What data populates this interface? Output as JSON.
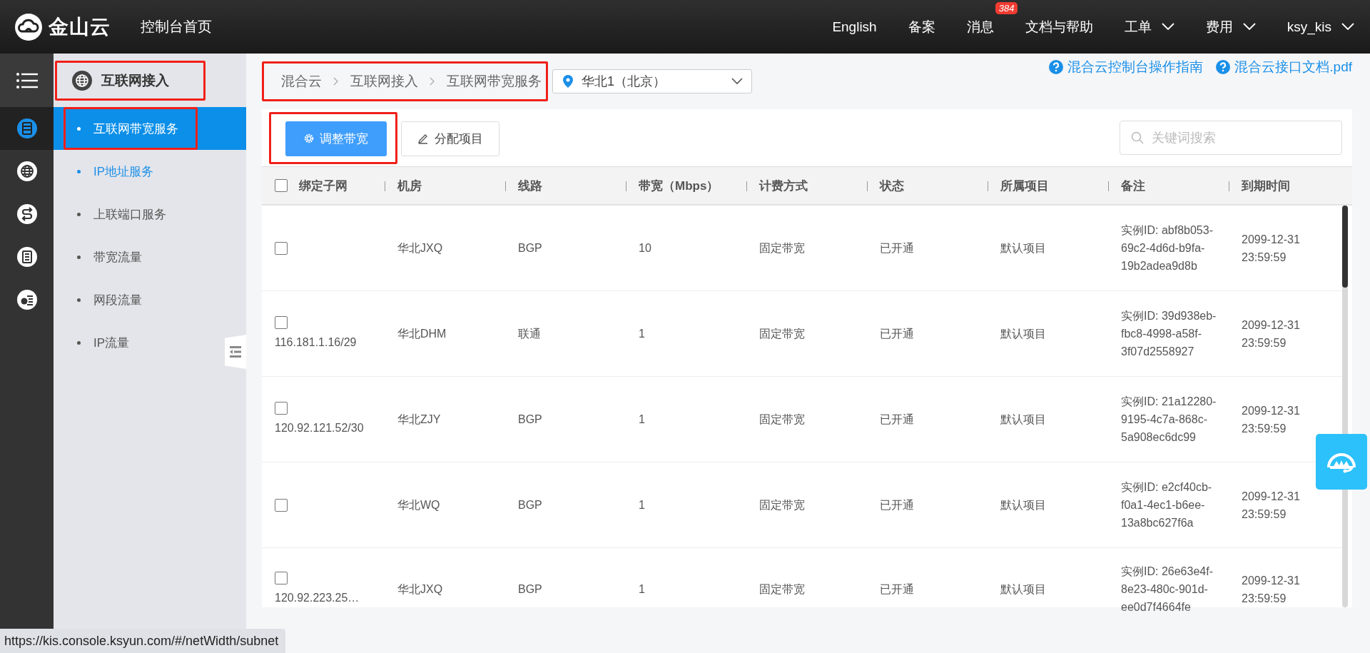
{
  "top_bar": {
    "logo_text": "金山云",
    "home_link": "控制台首页",
    "nav": [
      {
        "label": "English",
        "kind": "link"
      },
      {
        "label": "备案",
        "kind": "link"
      },
      {
        "label": "消息",
        "kind": "badge",
        "badge": "384"
      },
      {
        "label": "文档与帮助",
        "kind": "link"
      },
      {
        "label": "工单",
        "kind": "dropdown"
      },
      {
        "label": "费用",
        "kind": "dropdown"
      },
      {
        "label": "ksy_kis",
        "kind": "dropdown"
      }
    ]
  },
  "icon_rail": {
    "items": [
      {
        "kind": "server",
        "selected": true
      },
      {
        "kind": "globe",
        "selected": false
      },
      {
        "kind": "transfer",
        "selected": false
      },
      {
        "kind": "list",
        "selected": false
      },
      {
        "kind": "billing",
        "selected": false
      }
    ]
  },
  "sidebar": {
    "title": "互联网接入",
    "title_outlined": true,
    "items": [
      {
        "label": "互联网带宽服务",
        "selected": true,
        "hovered": false,
        "outlined": true
      },
      {
        "label": "IP地址服务",
        "selected": false,
        "hovered": true,
        "outlined": false
      },
      {
        "label": "上联端口服务",
        "selected": false,
        "hovered": false,
        "outlined": false
      },
      {
        "label": "带宽流量",
        "selected": false,
        "hovered": false,
        "outlined": false
      },
      {
        "label": "网段流量",
        "selected": false,
        "hovered": false,
        "outlined": false
      },
      {
        "label": "IP流量",
        "selected": false,
        "hovered": false,
        "outlined": false
      }
    ]
  },
  "breadcrumb": {
    "outlined": true,
    "items": [
      "混合云",
      "互联网接入",
      "互联网带宽服务"
    ]
  },
  "region_select": {
    "value": "华北1（北京）"
  },
  "help_links": [
    "混合云控制台操作指南",
    "混合云接口文档.pdf"
  ],
  "toolbar": {
    "buttons": [
      {
        "label": "调整带宽",
        "kind": "primary",
        "outlined": true
      },
      {
        "label": "分配项目",
        "kind": "default",
        "outlined": false
      }
    ],
    "search": {
      "placeholder": "关键词搜索"
    }
  },
  "table": {
    "header_checked": false,
    "columns": [
      "绑定子网",
      "机房",
      "线路",
      "带宽（Mbps）",
      "计费方式",
      "状态",
      "所属项目",
      "备注",
      "到期时间"
    ],
    "rows": [
      {
        "checked": false,
        "cells": [
          "",
          "华北JXQ",
          "BGP",
          "10",
          "固定带宽",
          "已开通",
          "默认项目",
          "实例ID: abf8b053-69c2-4d6d-b9fa-19b2adea9d8b",
          "2099-12-31 23:59:59"
        ]
      },
      {
        "checked": false,
        "cells": [
          "116.181.1.16/29",
          "华北DHM",
          "联通",
          "1",
          "固定带宽",
          "已开通",
          "默认项目",
          "实例ID: 39d938eb-fbc8-4998-a58f-3f07d2558927",
          "2099-12-31 23:59:59"
        ]
      },
      {
        "checked": false,
        "cells": [
          "120.92.121.52/30",
          "华北ZJY",
          "BGP",
          "1",
          "固定带宽",
          "已开通",
          "默认项目",
          "实例ID: 21a12280-9195-4c7a-868c-5a908ec6dc99",
          "2099-12-31 23:59:59"
        ]
      },
      {
        "checked": false,
        "cells": [
          "",
          "华北WQ",
          "BGP",
          "1",
          "固定带宽",
          "已开通",
          "默认项目",
          "实例ID: e2cf40cb-f0a1-4ec1-b6ee-13a8bc627f6a",
          "2099-12-31 23:59:59"
        ]
      },
      {
        "checked": false,
        "cells": [
          "120.92.223.25…",
          "华北JXQ",
          "BGP",
          "1",
          "固定带宽",
          "已开通",
          "默认项目",
          "实例ID: 26e63e4f-8e23-480c-901d-ee0d7f4664fe",
          "2099-12-31 23:59:59"
        ]
      }
    ]
  },
  "status_bar": {
    "url": "https://kis.console.ksyun.com/#/netWidth/subnet"
  }
}
